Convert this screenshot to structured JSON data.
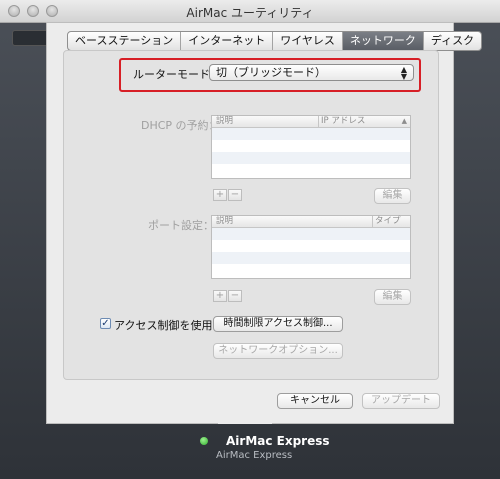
{
  "window": {
    "title": "AirMac ユーティリティ"
  },
  "tabs": [
    {
      "label": "ベースステーション",
      "selected": false
    },
    {
      "label": "インターネット",
      "selected": false
    },
    {
      "label": "ワイヤレス",
      "selected": false
    },
    {
      "label": "ネットワーク",
      "selected": true
    },
    {
      "label": "ディスク",
      "selected": false
    }
  ],
  "router_mode": {
    "label": "ルーターモード：",
    "value": "切（ブリッジモード）"
  },
  "dhcp": {
    "label": "DHCP の予約：",
    "columns": [
      "説明",
      "IP アドレス"
    ],
    "add": "+",
    "remove": "−",
    "edit": "編集"
  },
  "port": {
    "label": "ポート設定：",
    "columns": [
      "説明",
      "タイプ"
    ],
    "add": "+",
    "remove": "−",
    "edit": "編集"
  },
  "access": {
    "checkbox_label": "アクセス制御を使用：",
    "checked": true,
    "timed_button": "時間制限アクセス制御...",
    "network_options_button": "ネットワークオプション..."
  },
  "footer": {
    "cancel": "キャンセル",
    "update": "アップデート"
  },
  "device": {
    "name": "AirMac Express",
    "subtitle": "AirMac Express",
    "status_color": "#33b12f"
  },
  "colors": {
    "highlight_border": "#d71f26",
    "selected_tab": "#5a5e65"
  }
}
